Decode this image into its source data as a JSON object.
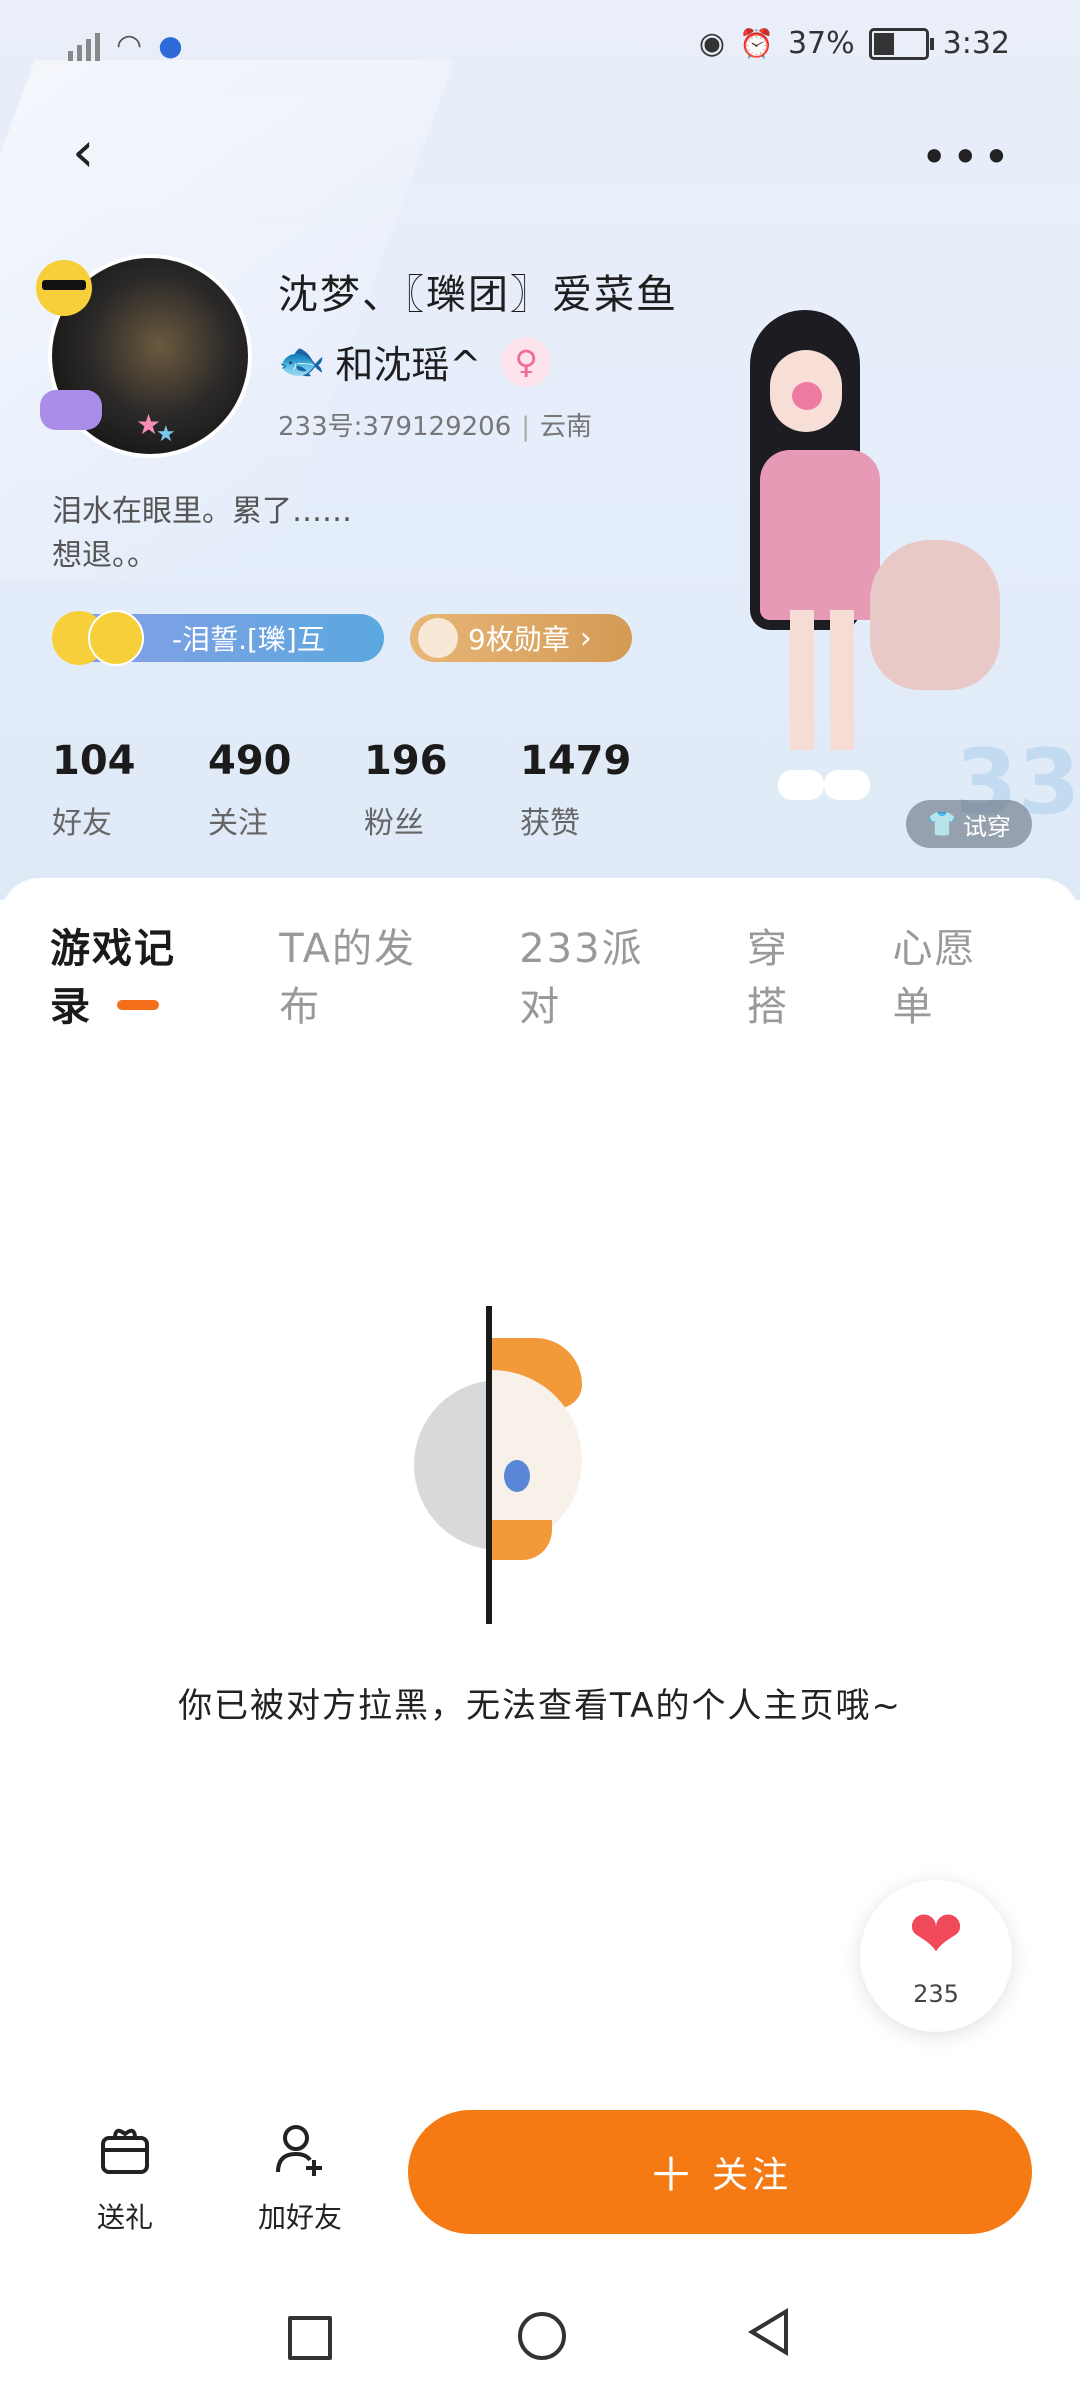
{
  "status_bar": {
    "battery_percent": "37%",
    "time": "3:32",
    "icons": [
      "signal-icon",
      "wifi-icon",
      "baidu-paw-icon",
      "eye-icon",
      "alarm-icon",
      "battery-icon"
    ],
    "battery_level": 0.37
  },
  "toolbar": {
    "back_icon": "chevron-left-icon",
    "more_icon": "more-dots-icon"
  },
  "profile": {
    "name": "沈梦、〖瓅团〗爱菜鱼",
    "sub_name": "和沈瑶^",
    "gender_icon": "female-icon",
    "id_text": "233号:379129206",
    "location": "云南",
    "bio_line1": "泪水在眼里。累了……",
    "bio_line2": "想退。。",
    "badge_group": "-泪誓.[瓅]互",
    "medals": "9枚勋章"
  },
  "stats": [
    {
      "value": "104",
      "label": "好友"
    },
    {
      "value": "490",
      "label": "关注"
    },
    {
      "value": "196",
      "label": "粉丝"
    },
    {
      "value": "1479",
      "label": "获赞"
    }
  ],
  "try_on_label": "试穿",
  "tabs": [
    {
      "label": "游戏记录",
      "active": true
    },
    {
      "label": "TA的发布",
      "active": false
    },
    {
      "label": "233派对",
      "active": false
    },
    {
      "label": "穿搭",
      "active": false
    },
    {
      "label": "心愿单",
      "active": false
    }
  ],
  "empty_state": {
    "message": "你已被对方拉黑，无法查看TA的个人主页哦~"
  },
  "like_fab": {
    "count": "235"
  },
  "bottom_bar": {
    "gift_label": "送礼",
    "add_friend_label": "加好友",
    "follow_label": "关注"
  },
  "colors": {
    "accent": "#f57a14",
    "tab_indicator": "#f36f1c",
    "heart": "#f04a5a"
  }
}
